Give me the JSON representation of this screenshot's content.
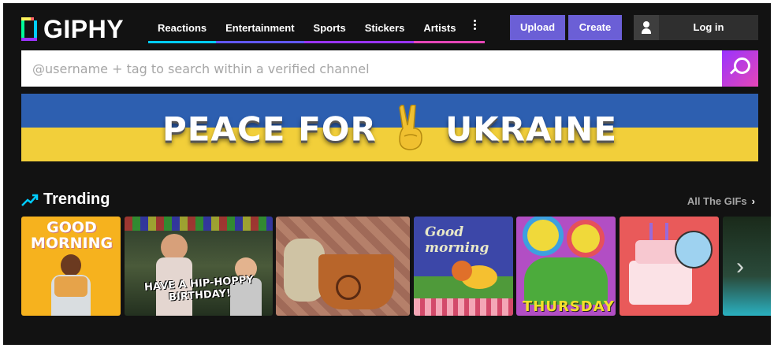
{
  "header": {
    "logo": "GIPHY",
    "nav": [
      {
        "label": "Reactions",
        "color": "#00ccff"
      },
      {
        "label": "Entertainment",
        "color": "#6157ff"
      },
      {
        "label": "Sports",
        "color": "#9933ff"
      },
      {
        "label": "Stickers",
        "color": "#e646b6"
      },
      {
        "label": "Artists",
        "color": "#e646b6"
      }
    ],
    "more_icon": "vertical-ellipsis-icon",
    "upload_label": "Upload",
    "create_label": "Create",
    "login_label": "Log in"
  },
  "search": {
    "placeholder": "@username + tag to search within a verified channel",
    "button_icon": "search-icon"
  },
  "banner": {
    "text_left": "PEACE FOR",
    "text_right": "UKRAINE",
    "colors": {
      "top": "#2d5fb0",
      "bottom": "#f2cf3a"
    }
  },
  "trending": {
    "title": "Trending",
    "all_label": "All The GIFs",
    "gifs": [
      {
        "caption": "GOOD MORNING"
      },
      {
        "caption": "HAVE A HIP-HOPPY BIRTHDAY!"
      },
      {
        "caption": ""
      },
      {
        "caption": "Good morning"
      },
      {
        "caption": "THURSDAY"
      },
      {
        "caption": ""
      },
      {
        "caption": ""
      }
    ]
  },
  "colors": {
    "background": "#121212",
    "accent": "#6b5fd6",
    "brand_gradient": [
      "#9933ff",
      "#e646b6"
    ]
  }
}
